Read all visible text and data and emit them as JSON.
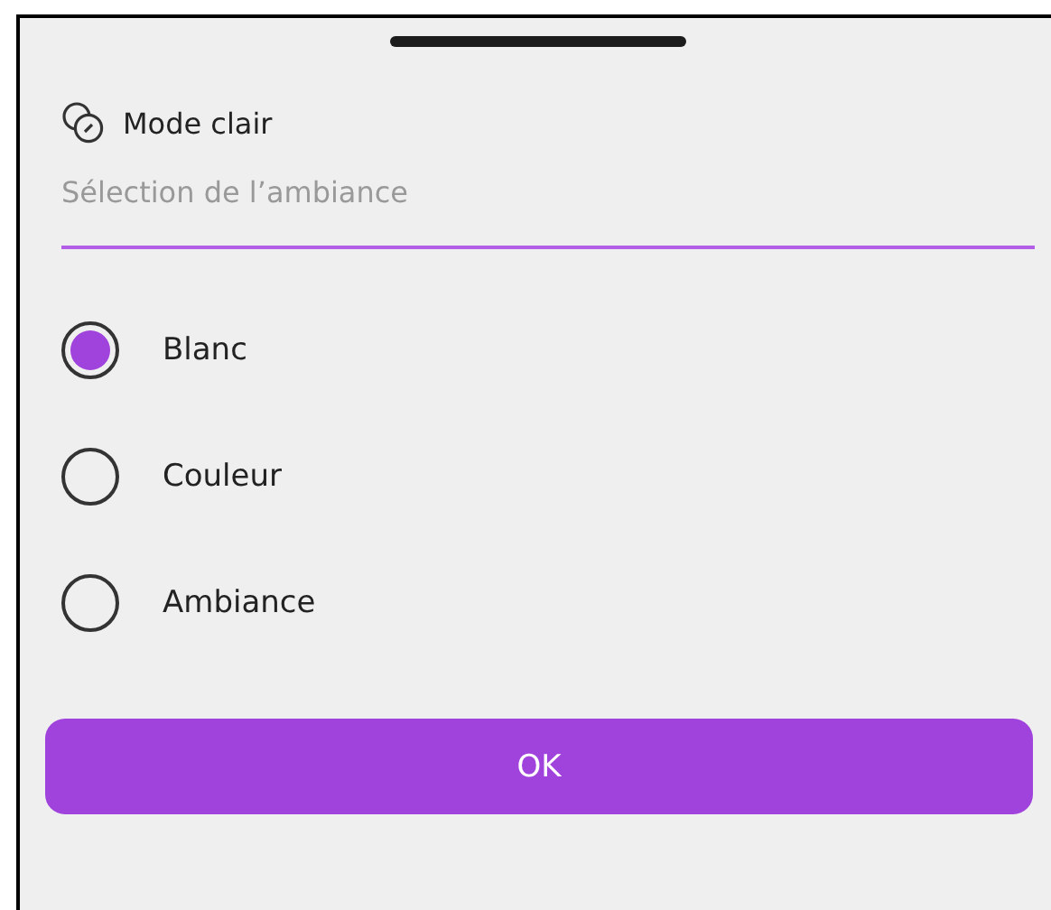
{
  "sheet": {
    "title": "Mode clair",
    "subtitle": "Sélection de l’ambiance"
  },
  "options": [
    {
      "label": "Blanc",
      "selected": true
    },
    {
      "label": "Couleur",
      "selected": false
    },
    {
      "label": "Ambiance",
      "selected": false
    }
  ],
  "button": {
    "label": "OK"
  }
}
